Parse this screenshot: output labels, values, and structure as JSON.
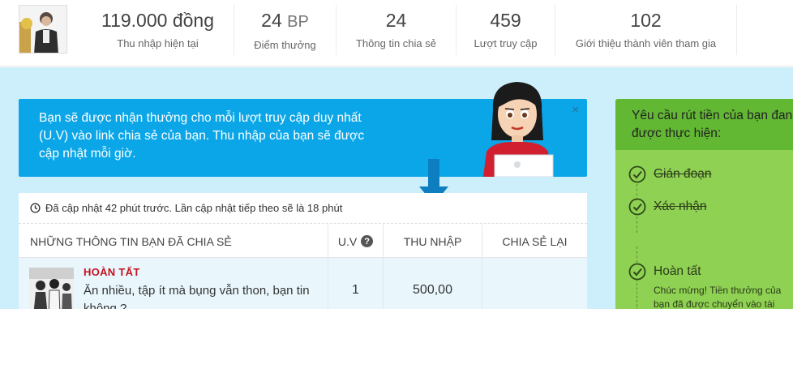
{
  "stats": [
    {
      "value": "119.000 đồng",
      "unit": "",
      "label": "Thu nhập hiện tại"
    },
    {
      "value": "24",
      "unit": "BP",
      "label": "Điểm thưởng"
    },
    {
      "value": "24",
      "unit": "",
      "label": "Thông tin chia sẻ"
    },
    {
      "value": "459",
      "unit": "",
      "label": "Lượt truy cập"
    },
    {
      "value": "102",
      "unit": "",
      "label": "Giới thiệu thành viên tham gia"
    }
  ],
  "notice": {
    "text": "Bạn sẽ được nhận thưởng cho mỗi lượt truy cập duy nhất (U.V) vào link chia sẻ của bạn. Thu nhập của bạn sẽ được cập nhật mỗi giờ.",
    "close": "×"
  },
  "shares": {
    "updated": "Đã cập nhật 42 phút trước. Lần cập nhật tiếp theo sẽ là 18 phút",
    "columns": {
      "info": "NHỮNG THÔNG TIN BẠN ĐÃ CHIA SẺ",
      "uv": "U.V",
      "uv_help": "?",
      "income": "THU NHẬP",
      "reshare": "CHIA SẺ LẠI"
    },
    "rows": [
      {
        "status": "HOÀN TẤT",
        "title": "Ăn nhiều, tập ít mà bụng vẫn thon, bạn tin không ?",
        "uv": "1",
        "income": "500,00",
        "reshare": ""
      }
    ]
  },
  "withdraw": {
    "title": "Yêu cầu rút tiền của bạn đang được thực hiện:",
    "steps": [
      {
        "label": "Gián đoạn",
        "done": true
      },
      {
        "label": "Xác nhận",
        "done": true
      },
      {
        "label": "Hoàn tất",
        "done": false
      }
    ],
    "note": "Chúc mừng! Tiền thưởng của bạn đã được chuyển vào tài khoản. Hãy chia sẻ với bạn bè về khoản tiền thưởng này!"
  },
  "colors": {
    "accent_blue": "#0aa6e8",
    "background_blue": "#cdeefb",
    "status_red": "#c4121f",
    "panel_green": "#8fd153",
    "panel_green_dark": "#62b833"
  }
}
